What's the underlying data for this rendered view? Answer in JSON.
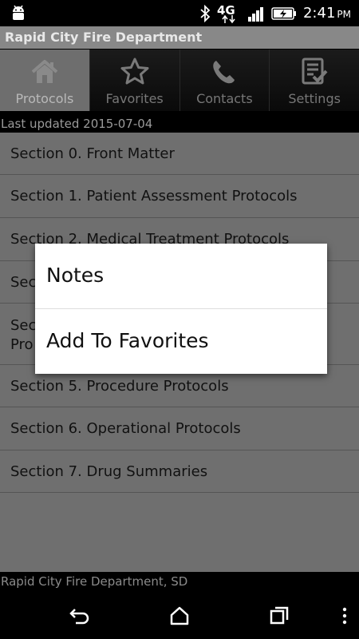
{
  "status": {
    "time": "2:41",
    "ampm": "PM",
    "network": "4G"
  },
  "app": {
    "title": "Rapid City Fire Department"
  },
  "tabs": [
    {
      "label": "Protocols",
      "icon": "home-icon",
      "active": true
    },
    {
      "label": "Favorites",
      "icon": "star-icon",
      "active": false
    },
    {
      "label": "Contacts",
      "icon": "phone-icon",
      "active": false
    },
    {
      "label": "Settings",
      "icon": "checklist-icon",
      "active": false
    }
  ],
  "last_updated": "Last updated 2015-07-04",
  "sections": [
    {
      "label": "Section 0. Front Matter"
    },
    {
      "label": "Section 1. Patient Assessment Protocols"
    },
    {
      "label": "Section 2. Medical Treatment Protocols"
    },
    {
      "label": "Sec"
    },
    {
      "label": "Sec",
      "line2": "Pro"
    },
    {
      "label": "Section 5. Procedure Protocols"
    },
    {
      "label": "Section 6. Operational Protocols"
    },
    {
      "label": "Section 7. Drug Summaries"
    }
  ],
  "footer": "Rapid City Fire Department, SD",
  "context_menu": {
    "items": [
      "Notes",
      "Add To Favorites"
    ]
  }
}
